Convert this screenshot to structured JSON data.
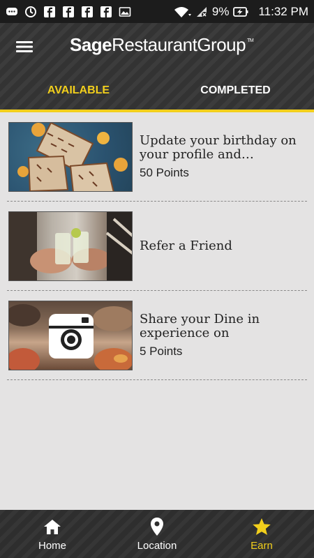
{
  "status_bar": {
    "battery": "9%",
    "time": "11:32 PM",
    "icons": [
      "messenger-icon",
      "sync-icon",
      "facebook-icon",
      "facebook-icon",
      "facebook-icon",
      "facebook-icon",
      "image-icon",
      "wifi-icon",
      "signal-icon",
      "battery-charging-icon"
    ]
  },
  "header": {
    "logo_bold": "Sage",
    "logo_light": "RestaurantGroup",
    "logo_tm": "TM"
  },
  "tabs": [
    {
      "label": "AVAILABLE",
      "active": true
    },
    {
      "label": "COMPLETED",
      "active": false
    }
  ],
  "rewards": [
    {
      "title": "Update your birthday on your profile and…",
      "points": "50 Points",
      "image": "dessert-photo"
    },
    {
      "title": "Refer a Friend",
      "points": "",
      "image": "friends-toast-photo"
    },
    {
      "title": "Share your Dine in experience on",
      "points": "5 Points",
      "image": "instagram-photo"
    }
  ],
  "bottom_nav": [
    {
      "label": "Home",
      "icon": "home-icon",
      "active": false
    },
    {
      "label": "Location",
      "icon": "location-pin-icon",
      "active": false
    },
    {
      "label": "Earn",
      "icon": "star-icon",
      "active": true
    }
  ],
  "colors": {
    "accent": "#f2cf1c",
    "header_bg": "#333333",
    "list_bg": "#e4e3e3"
  }
}
